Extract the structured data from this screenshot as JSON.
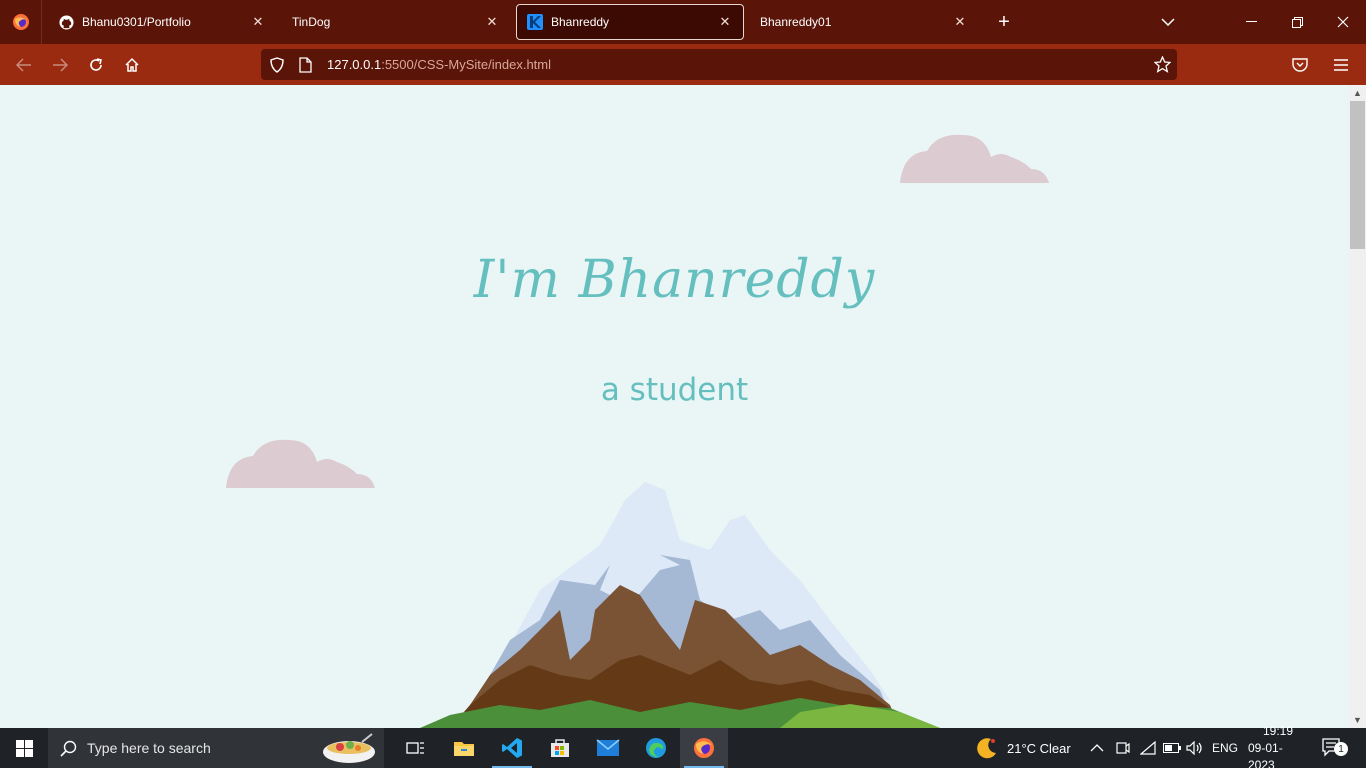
{
  "tabs": [
    {
      "title": "Bhanu0301/Portfolio",
      "icon": "github-icon"
    },
    {
      "title": "TinDog",
      "icon": "none"
    },
    {
      "title": "Bhanreddy",
      "icon": "site-favicon-icon"
    },
    {
      "title": "Bhanreddy01",
      "icon": "none"
    }
  ],
  "url": {
    "host": "127.0.0.1",
    "path": ":5500/CSS-MySite/index.html"
  },
  "page": {
    "title": "I'm Bhanreddy",
    "subtitle": "a student"
  },
  "colors": {
    "accent": "#66bfbf",
    "background": "#eaf6f6",
    "cloud": "#dccbd0",
    "tabbar": "#5a1408",
    "navbar": "#9b2b10"
  },
  "taskbar": {
    "search_placeholder": "Type here to search",
    "weather": "21°C  Clear",
    "language": "ENG",
    "time": "19:19",
    "date": "09-01-2023",
    "notification_count": "1"
  }
}
